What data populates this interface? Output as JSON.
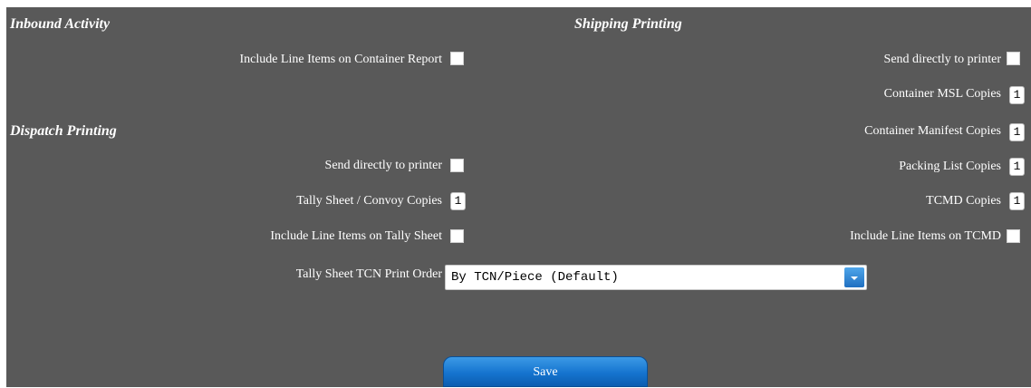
{
  "inbound": {
    "title": "Inbound Activity",
    "include_line_items_container_label": "Include Line Items on Container Report"
  },
  "dispatch": {
    "title": "Dispatch Printing",
    "send_directly_label": "Send directly to printer",
    "tally_copies_label": "Tally Sheet / Convoy Copies",
    "tally_copies_value": "1",
    "include_line_items_tally_label": "Include Line Items on Tally Sheet",
    "tcn_print_order_label": "Tally Sheet TCN Print Order",
    "tcn_print_order_value": "By TCN/Piece (Default)"
  },
  "shipping": {
    "title": "Shipping Printing",
    "send_directly_label": "Send directly to printer",
    "msl_copies_label": "Container MSL Copies",
    "msl_copies_value": "1",
    "manifest_copies_label": "Container Manifest Copies",
    "manifest_copies_value": "1",
    "packing_list_copies_label": "Packing List Copies",
    "packing_list_copies_value": "1",
    "tcmd_copies_label": "TCMD Copies",
    "tcmd_copies_value": "1",
    "include_line_items_tcmd_label": "Include Line Items on TCMD"
  },
  "actions": {
    "save_label": "Save"
  },
  "colors": {
    "panel_bg": "#595959",
    "button_blue": "#1574cf",
    "select_arrow_blue": "#2b84d6"
  },
  "icons": {
    "select_arrow": "chevron-down-icon"
  }
}
